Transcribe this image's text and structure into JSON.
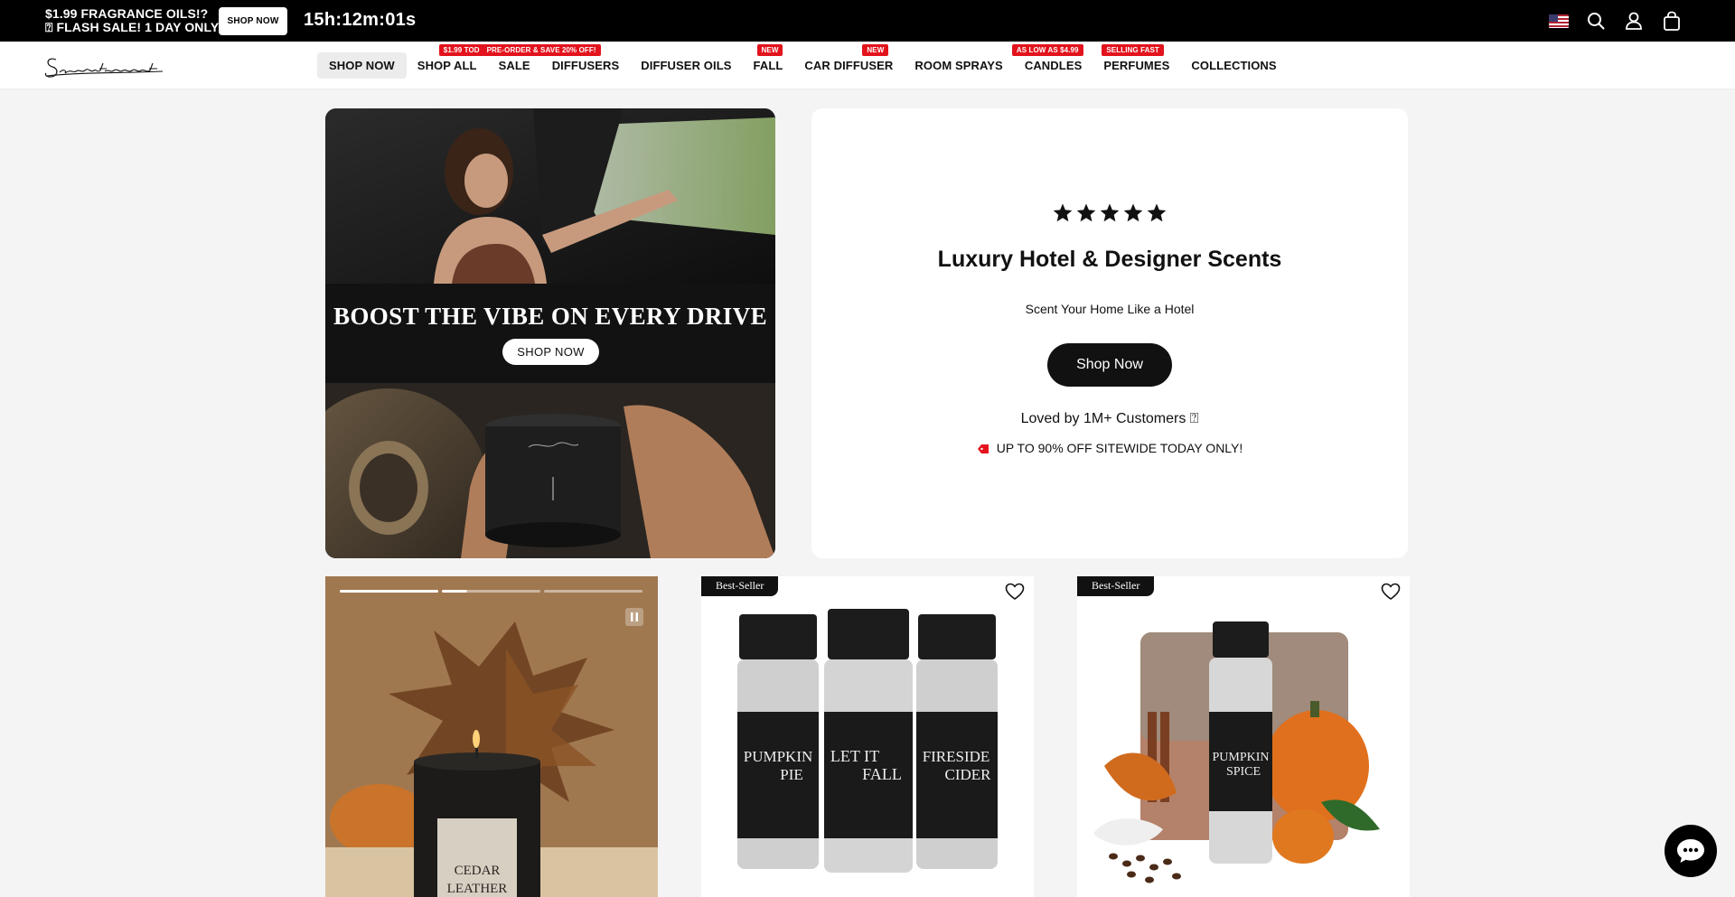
{
  "promo_bar": {
    "line1": "$1.99 FRAGRANCE OILS!?",
    "line2": "⍰ FLASH SALE! 1 DAY ONLY!",
    "button_label": "SHOP NOW",
    "countdown": "15h:12m:01s"
  },
  "header_icons": [
    "us-flag-icon",
    "search-icon",
    "account-icon",
    "cart-icon"
  ],
  "nav": {
    "items": [
      {
        "label": "SHOP NOW",
        "badge": ""
      },
      {
        "label": "SHOP ALL",
        "badge": "$1.99 TOD"
      },
      {
        "label": "SALE",
        "badge": "PRE-ORDER & SAVE 20% OFF!"
      },
      {
        "label": "DIFFUSERS",
        "badge": ""
      },
      {
        "label": "DIFFUSER OILS",
        "badge": ""
      },
      {
        "label": "FALL",
        "badge": "NEW"
      },
      {
        "label": "CAR DIFFUSER",
        "badge": "NEW"
      },
      {
        "label": "ROOM SPRAYS",
        "badge": ""
      },
      {
        "label": "CANDLES",
        "badge": "AS LOW AS $4.99"
      },
      {
        "label": "PERFUMES",
        "badge": "SELLING FAST"
      },
      {
        "label": "COLLECTIONS",
        "badge": ""
      }
    ]
  },
  "hero_banner": {
    "headline": "BOOST THE VIBE ON EVERY DRIVE",
    "cta": "SHOP NOW"
  },
  "hero_card": {
    "rating_stars": 5,
    "title": "Luxury Hotel & Designer Scents",
    "subtitle": "Scent Your Home Like a Hotel",
    "button_label": "Shop Now",
    "loved_text": "Loved by 1M+ Customers ⍰",
    "promo_text": "UP TO 90% OFF SITEWIDE TODAY ONLY!"
  },
  "video_tile": {
    "slides_total": 3,
    "slide_progress": [
      1,
      0.25,
      0
    ]
  },
  "products": [
    {
      "badge": "Best-Seller",
      "bottles": [
        "PUMPKIN PIE",
        "LET IT FALL",
        "FIRESIDE CIDER"
      ]
    },
    {
      "badge": "Best-Seller",
      "bottle": "PUMPKIN SPICE"
    }
  ],
  "colors": {
    "promo_bg": "#000000",
    "badge_red": "#e3131d",
    "page_bg": "#f4f4f4",
    "button_dark": "#111111"
  }
}
